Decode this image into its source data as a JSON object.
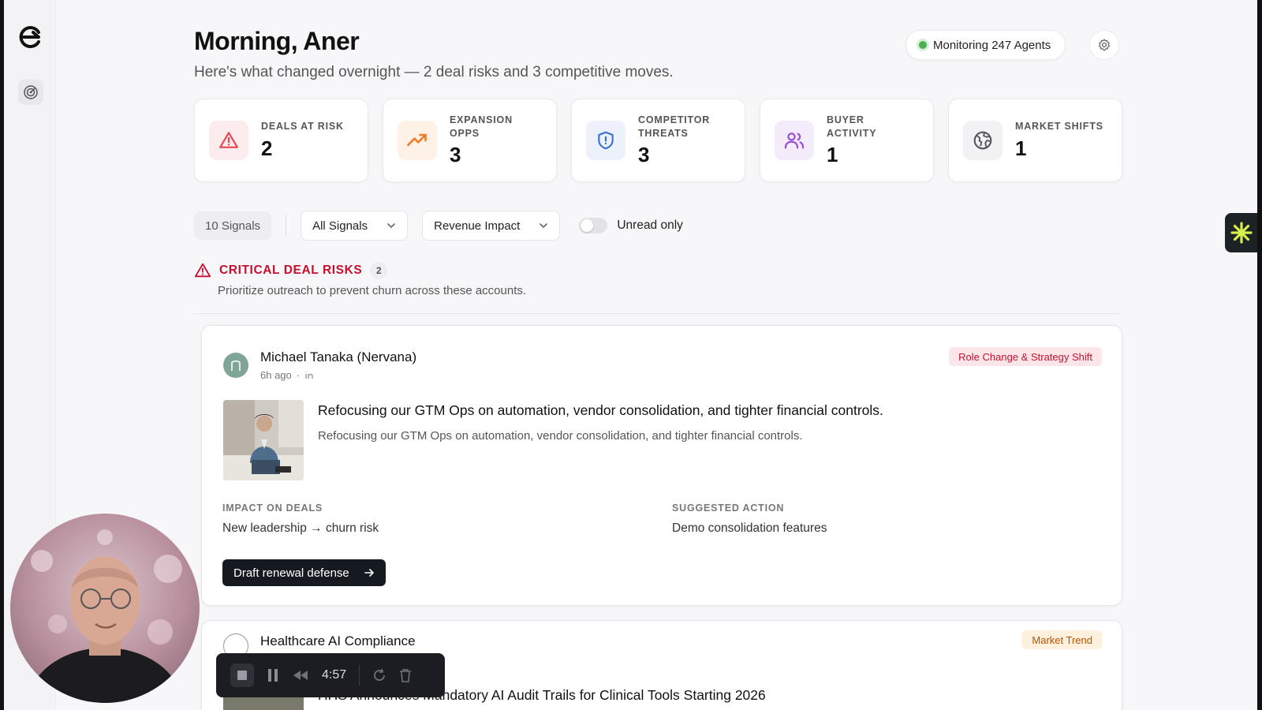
{
  "header": {
    "greeting": "Morning, Aner",
    "subtitle": "Here's what changed overnight — 2 deal risks and 3 competitive moves.",
    "monitoring_label": "Monitoring 247 Agents"
  },
  "stats": [
    {
      "label_line1": "DEALS AT RISK",
      "label_line2": "",
      "value": "2",
      "icon": "alert-triangle-icon",
      "color": "#e5484d"
    },
    {
      "label_line1": "EXPANSION",
      "label_line2": "OPPS",
      "value": "3",
      "icon": "trending-up-icon",
      "color": "#f07a2a"
    },
    {
      "label_line1": "COMPETITOR",
      "label_line2": "THREATS",
      "value": "3",
      "icon": "shield-alert-icon",
      "color": "#3b6fd8"
    },
    {
      "label_line1": "BUYER",
      "label_line2": "ACTIVITY",
      "value": "1",
      "icon": "users-icon",
      "color": "#9b4fd6"
    },
    {
      "label_line1": "MARKET SHIFTS",
      "label_line2": "",
      "value": "1",
      "icon": "globe-icon",
      "color": "#555555"
    }
  ],
  "toolbar": {
    "signal_count": "10 Signals",
    "filter_select": "All Signals",
    "sort_select": "Revenue Impact",
    "unread_label": "Unread only"
  },
  "section": {
    "title": "CRITICAL DEAL RISKS",
    "count": "2",
    "description": "Prioritize outreach to prevent churn across these accounts."
  },
  "cards": [
    {
      "person": "Michael Tanaka (Nervana)",
      "time": "6h ago",
      "tag": "Role Change & Strategy Shift",
      "title": "Refocusing our GTM Ops on automation, vendor consolidation, and tighter financial controls.",
      "body": "Refocusing our GTM Ops on automation, vendor consolidation, and tighter financial controls.",
      "impact_label": "IMPACT ON DEALS",
      "impact_value": "New leadership → churn risk",
      "action_label": "SUGGESTED ACTION",
      "action_value": "Demo consolidation features",
      "cta": "Draft renewal defense"
    },
    {
      "person": "Healthcare AI Compliance",
      "tag": "Market Trend",
      "title": "HHS Announces Mandatory AI Audit Trails for Clinical Tools Starting 2026"
    }
  ],
  "recorder": {
    "time": "4:57"
  },
  "colors": {
    "critical": "#c8102e",
    "accent_dark": "#141a20",
    "live": "#4caf50"
  }
}
